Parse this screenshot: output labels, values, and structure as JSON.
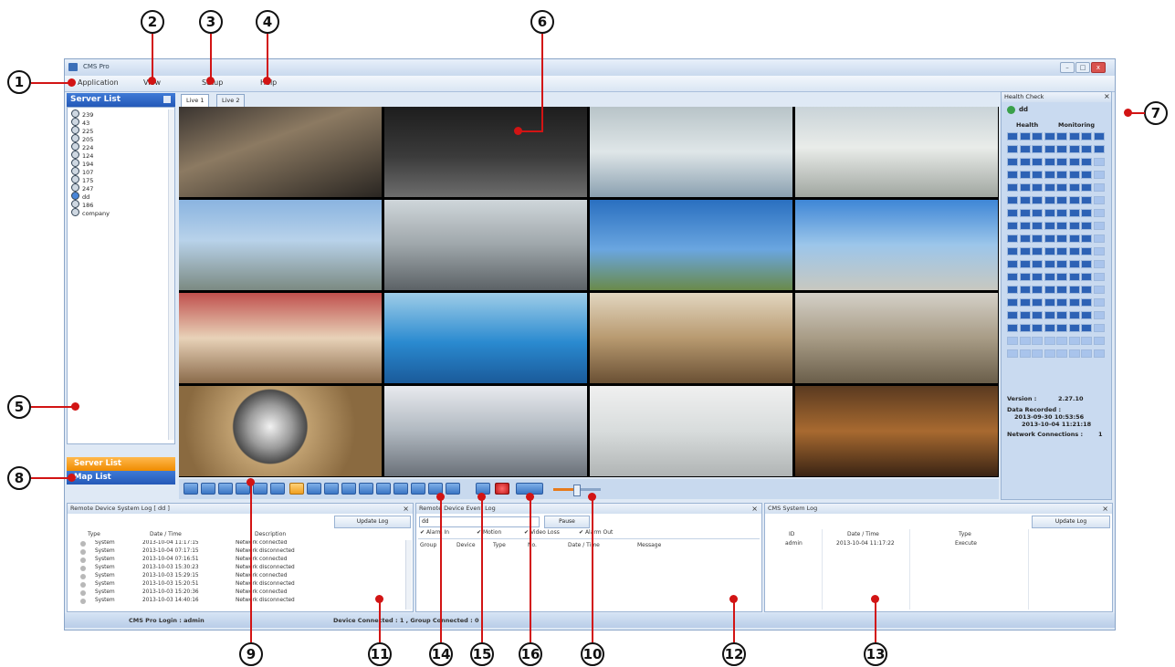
{
  "window": {
    "title": "CMS Pro"
  },
  "menu": {
    "application": "Application",
    "view": "View",
    "setup": "Setup",
    "help": "Help"
  },
  "server_list": {
    "title": "Server List",
    "items": [
      "239",
      "43",
      "225",
      "205",
      "224",
      "124",
      "194",
      "107",
      "175",
      "247",
      "dd",
      "186",
      "company"
    ]
  },
  "side_buttons": {
    "server_list": "Server List",
    "map_list": "Map List"
  },
  "tabs": [
    "Live 1",
    "Live 2"
  ],
  "health": {
    "title": "Health Check",
    "group": "dd",
    "col_health": "Health",
    "col_monitoring": "Monitoring",
    "version_label": "Version :",
    "version_value": "2.27.10",
    "recorded_label": "Data Recorded :",
    "recorded_from": "2013-09-30 10:53:56",
    "recorded_to": "2013-10-04 11:21:18",
    "network_label": "Network Connections :",
    "network_value": "1"
  },
  "system_log": {
    "title": "Remote Device System Log  [ dd ]",
    "button": "Update Log",
    "columns": [
      "Type",
      "Date / Time",
      "Description"
    ],
    "rows": [
      [
        "System",
        "2013-10-04 11:17:15",
        "Network connected"
      ],
      [
        "System",
        "2013-10-04 07:17:15",
        "Network disconnected"
      ],
      [
        "System",
        "2013-10-04 07:16:51",
        "Network connected"
      ],
      [
        "System",
        "2013-10-03 15:30:23",
        "Network disconnected"
      ],
      [
        "System",
        "2013-10-03 15:29:15",
        "Network connected"
      ],
      [
        "System",
        "2013-10-03 15:20:51",
        "Network disconnected"
      ],
      [
        "System",
        "2013-10-03 15:20:36",
        "Network connected"
      ],
      [
        "System",
        "2013-10-03 14:40:16",
        "Network disconnected"
      ]
    ]
  },
  "event_log": {
    "title": "Remote Device Event Log",
    "select_value": "dd",
    "pause": "Pause",
    "checks": [
      "Alarm In",
      "Motion",
      "Video Loss",
      "Alarm Out"
    ],
    "columns": [
      "Group",
      "Device",
      "Type",
      "No.",
      "Date / Time",
      "Message"
    ]
  },
  "cms_log": {
    "title": "CMS System Log",
    "button": "Update Log",
    "columns": [
      "ID",
      "Date / Time",
      "Type"
    ],
    "rows": [
      [
        "admin",
        "2013-10-04 11:17:22",
        "Execute"
      ]
    ]
  },
  "status": {
    "login": "CMS Pro Login : admin",
    "connected": "Device Connected : 1 , Group Connected : 0"
  },
  "callouts": [
    "1",
    "2",
    "3",
    "4",
    "5",
    "6",
    "7",
    "8",
    "9",
    "10",
    "11",
    "12",
    "13",
    "14",
    "15",
    "16"
  ],
  "colors": {
    "accent": "#2459b8",
    "highlight": "#f08c00",
    "callout_line": "#d21414"
  }
}
